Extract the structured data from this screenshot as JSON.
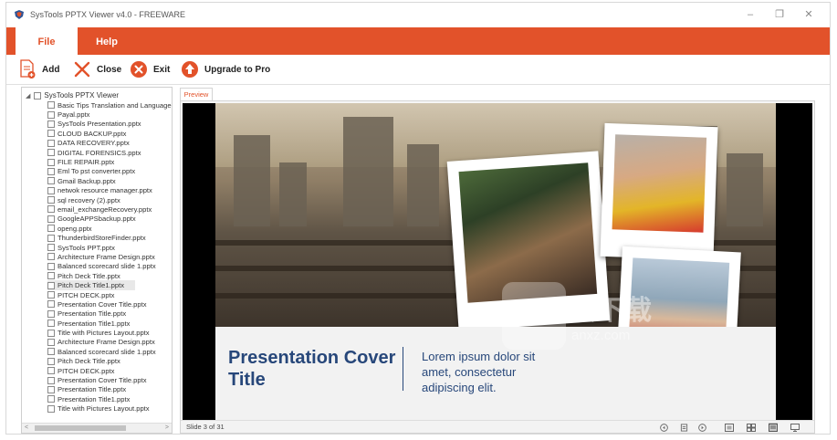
{
  "window": {
    "title": "SysTools PPTX Viewer v4.0 - FREEWARE",
    "controls": {
      "minimize": "–",
      "maximize": "❐",
      "close": "✕"
    }
  },
  "ribbon": {
    "tabs": [
      {
        "label": "File",
        "active": true
      },
      {
        "label": "Help",
        "active": false
      }
    ],
    "accent_color": "#e2522a"
  },
  "toolbar": {
    "add_label": "Add",
    "close_label": "Close",
    "exit_label": "Exit",
    "upgrade_label": "Upgrade to Pro"
  },
  "tree": {
    "root_label": "SysTools PPTX Viewer",
    "items": [
      "Basic Tips Translation and Language C",
      "Payal.pptx",
      "SysTools Presentation.pptx",
      "CLOUD BACKUP.pptx",
      "DATA RECOVERY.pptx",
      "DIGITAL FORENSICS.pptx",
      "FILE REPAIR.pptx",
      "Eml To pst converter.pptx",
      "Gmail Backup.pptx",
      "netwok resource manager.pptx",
      "sql recovery (2).pptx",
      "email_exchangeRecovery.pptx",
      "GoogleAPPSbackup.pptx",
      "openg.pptx",
      "ThunderbirdStoreFinder.pptx",
      "SysTools PPT.pptx",
      "Architecture Frame Design.pptx",
      "Balanced scorecard slide 1.pptx",
      "Pitch Deck Title.pptx",
      "Pitch Deck Title1.pptx",
      "PITCH DECK.pptx",
      "Presentation Cover Title.pptx",
      "Presentation Title.pptx",
      "Presentation Title1.pptx",
      "Title with Pictures Layout.pptx",
      "Architecture Frame Design.pptx",
      "Balanced scorecard slide 1.pptx",
      "Pitch Deck Title.pptx",
      "PITCH DECK.pptx",
      "Presentation Cover Title.pptx",
      "Presentation Title.pptx",
      "Presentation Title1.pptx",
      "Title with Pictures Layout.pptx"
    ],
    "selected_index": 19
  },
  "preview": {
    "tab_label": "Preview",
    "slide": {
      "title": "Presentation Cover Title",
      "body": "Lorem ipsum dolor sit amet, consectetur adipiscing elit.",
      "title_color": "#27477a"
    },
    "status": "Slide 3 of 31"
  },
  "watermark": {
    "main": "安下载",
    "sub": "anxz.com"
  }
}
